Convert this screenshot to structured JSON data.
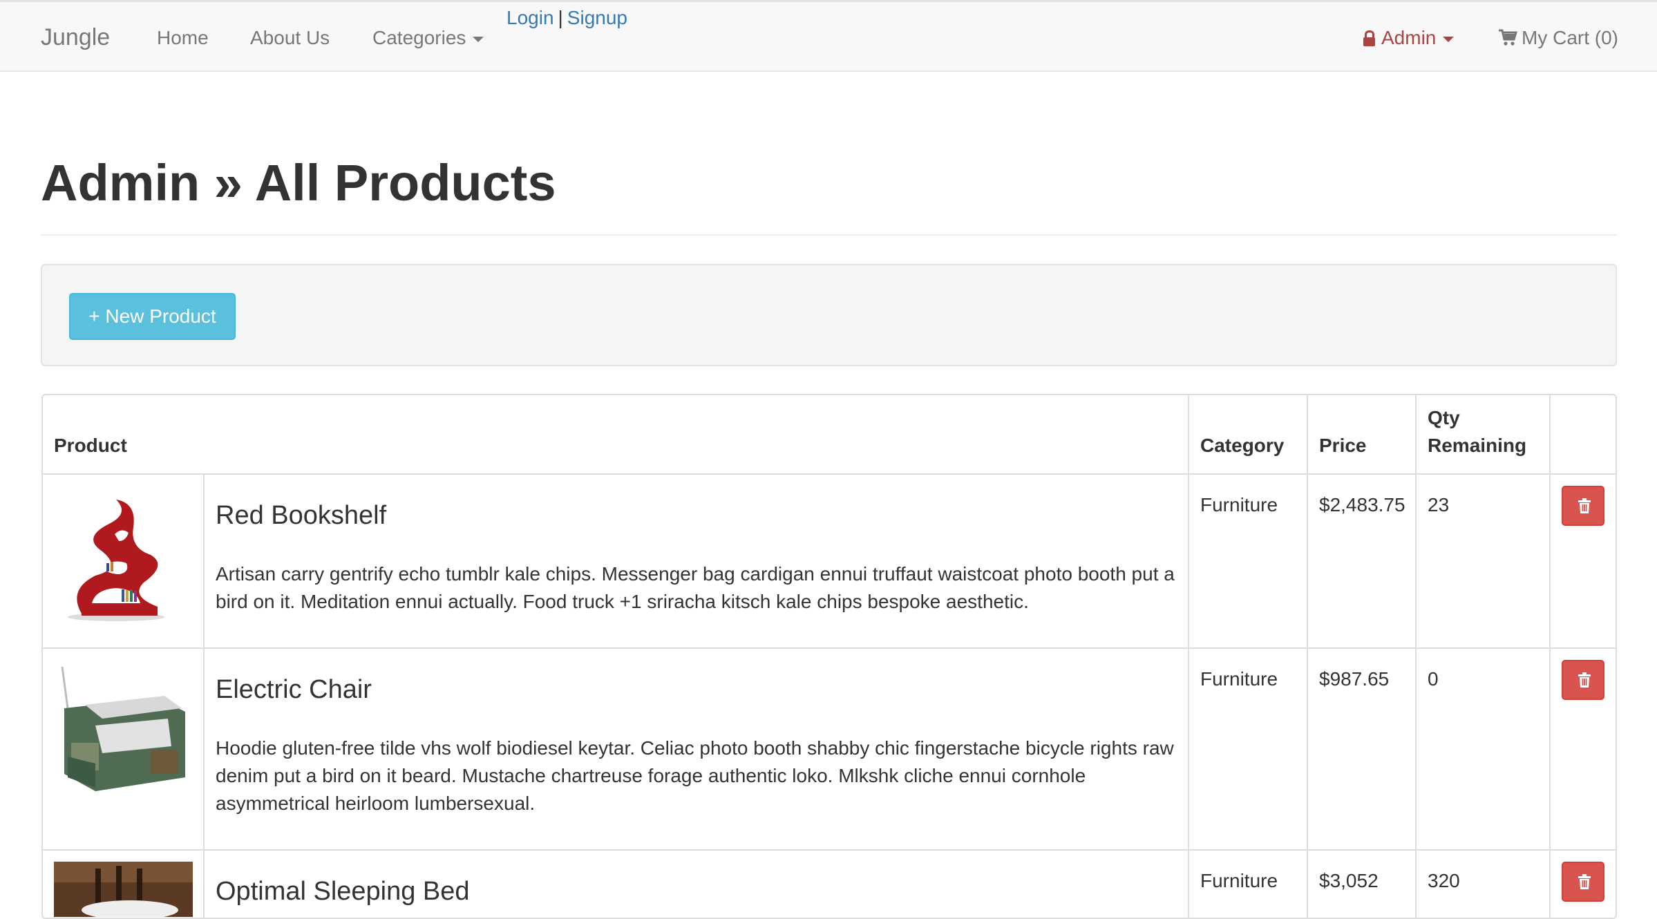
{
  "navbar": {
    "brand": "Jungle",
    "links": [
      "Home",
      "About Us",
      "Categories"
    ],
    "auth": {
      "login": "Login",
      "separator": "|",
      "signup": "Signup"
    },
    "admin": "Admin",
    "cart": "My Cart (0)",
    "icons": {
      "lock": "lock-icon",
      "cart": "shopping-cart-icon",
      "caret": "caret-down-icon"
    },
    "colors": {
      "admin": "#a94442",
      "link": "#337ab7"
    }
  },
  "page": {
    "title": "Admin » All Products",
    "new_product_label": "+ New Product"
  },
  "table": {
    "headers": {
      "product": "Product",
      "category": "Category",
      "price": "Price",
      "qty": "Qty Remaining"
    },
    "rows": [
      {
        "name": "Red Bookshelf",
        "description": "Artisan carry gentrify echo tumblr kale chips. Messenger bag cardigan ennui truffaut waistcoat photo booth put a bird on it. Meditation ennui actually. Food truck +1 sriracha kitsch kale chips bespoke aesthetic.",
        "category": "Furniture",
        "price": "$2,483.75",
        "qty": "23",
        "image": "red-bookshelf-thumbnail"
      },
      {
        "name": "Electric Chair",
        "description": "Hoodie gluten-free tilde vhs wolf biodiesel keytar. Celiac photo booth shabby chic fingerstache bicycle rights raw denim put a bird on it beard. Mustache chartreuse forage authentic loko. Mlkshk cliche ennui cornhole asymmetrical heirloom lumbersexual.",
        "category": "Furniture",
        "price": "$987.65",
        "qty": "0",
        "image": "electric-chair-thumbnail"
      },
      {
        "name": "Optimal Sleeping Bed",
        "description": "",
        "category": "Furniture",
        "price": "$3,052",
        "qty": "320",
        "image": "sleeping-bed-thumbnail"
      }
    ],
    "delete_icon": "trash-icon",
    "colors": {
      "delete": "#d9534f",
      "new_button": "#5bc0de"
    }
  }
}
